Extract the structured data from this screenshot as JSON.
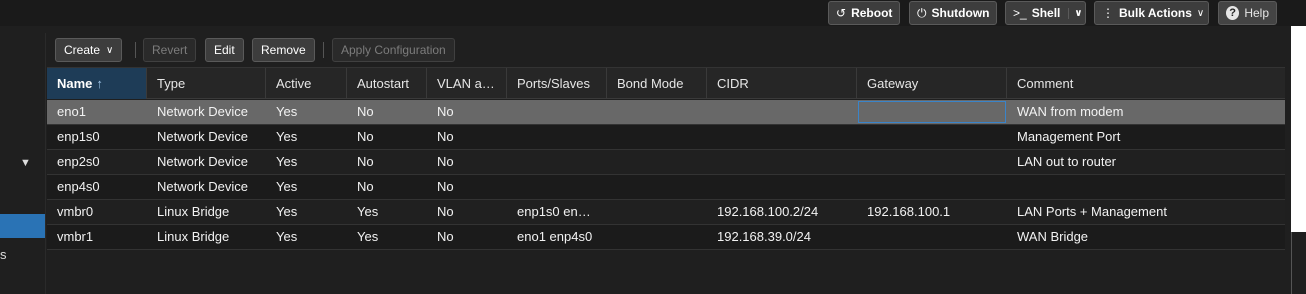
{
  "header": {
    "reboot_label": "Reboot",
    "shutdown_label": "Shutdown",
    "shell_label": "Shell",
    "bulk_actions_label": "Bulk Actions",
    "help_label": "Help"
  },
  "sidebar": {
    "fragment_text": "s"
  },
  "toolbar": {
    "create_label": "Create",
    "revert_label": "Revert",
    "edit_label": "Edit",
    "remove_label": "Remove",
    "apply_label": "Apply Configuration"
  },
  "grid": {
    "columns": [
      "Name",
      "Type",
      "Active",
      "Autostart",
      "VLAN a…",
      "Ports/Slaves",
      "Bond Mode",
      "CIDR",
      "Gateway",
      "Comment"
    ],
    "sort_column": "Name",
    "sort_direction": "ascending",
    "rows": [
      {
        "name": "eno1",
        "type": "Network Device",
        "active": "Yes",
        "autostart": "No",
        "vlan": "No",
        "ports": "",
        "bond": "",
        "cidr": "",
        "gateway": "",
        "comment": "WAN from modem"
      },
      {
        "name": "enp1s0",
        "type": "Network Device",
        "active": "Yes",
        "autostart": "No",
        "vlan": "No",
        "ports": "",
        "bond": "",
        "cidr": "",
        "gateway": "",
        "comment": "Management Port"
      },
      {
        "name": "enp2s0",
        "type": "Network Device",
        "active": "Yes",
        "autostart": "No",
        "vlan": "No",
        "ports": "",
        "bond": "",
        "cidr": "",
        "gateway": "",
        "comment": "LAN out to router"
      },
      {
        "name": "enp4s0",
        "type": "Network Device",
        "active": "Yes",
        "autostart": "No",
        "vlan": "No",
        "ports": "",
        "bond": "",
        "cidr": "",
        "gateway": "",
        "comment": ""
      },
      {
        "name": "vmbr0",
        "type": "Linux Bridge",
        "active": "Yes",
        "autostart": "Yes",
        "vlan": "No",
        "ports": "enp1s0 en…",
        "bond": "",
        "cidr": "192.168.100.2/24",
        "gateway": "192.168.100.1",
        "comment": "LAN Ports + Management"
      },
      {
        "name": "vmbr1",
        "type": "Linux Bridge",
        "active": "Yes",
        "autostart": "Yes",
        "vlan": "No",
        "ports": "eno1 enp4s0",
        "bond": "",
        "cidr": "192.168.39.0/24",
        "gateway": "",
        "comment": "WAN Bridge"
      }
    ]
  },
  "colors": {
    "selected_row": "#686868",
    "sorted_header": "#1e3c57",
    "nav_selected": "#2a73b5",
    "focus_border": "#3a84c9"
  }
}
